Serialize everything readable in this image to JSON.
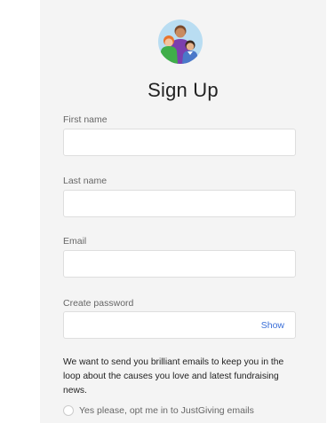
{
  "header": {
    "logo_icon": "family-avatar-icon",
    "title": "Sign Up"
  },
  "form": {
    "first_name": {
      "label": "First name",
      "value": ""
    },
    "last_name": {
      "label": "Last name",
      "value": ""
    },
    "email": {
      "label": "Email",
      "value": ""
    },
    "password": {
      "label": "Create password",
      "value": "",
      "toggle_label": "Show"
    }
  },
  "marketing": {
    "text": "We want to send you brilliant emails to keep you in the loop about the causes you love and latest fundraising news.",
    "optin_label": "Yes please, opt me in to JustGiving emails",
    "optin_checked": false
  },
  "colors": {
    "accent": "#3a6fd8",
    "panel_bg": "#f4f4f4"
  }
}
